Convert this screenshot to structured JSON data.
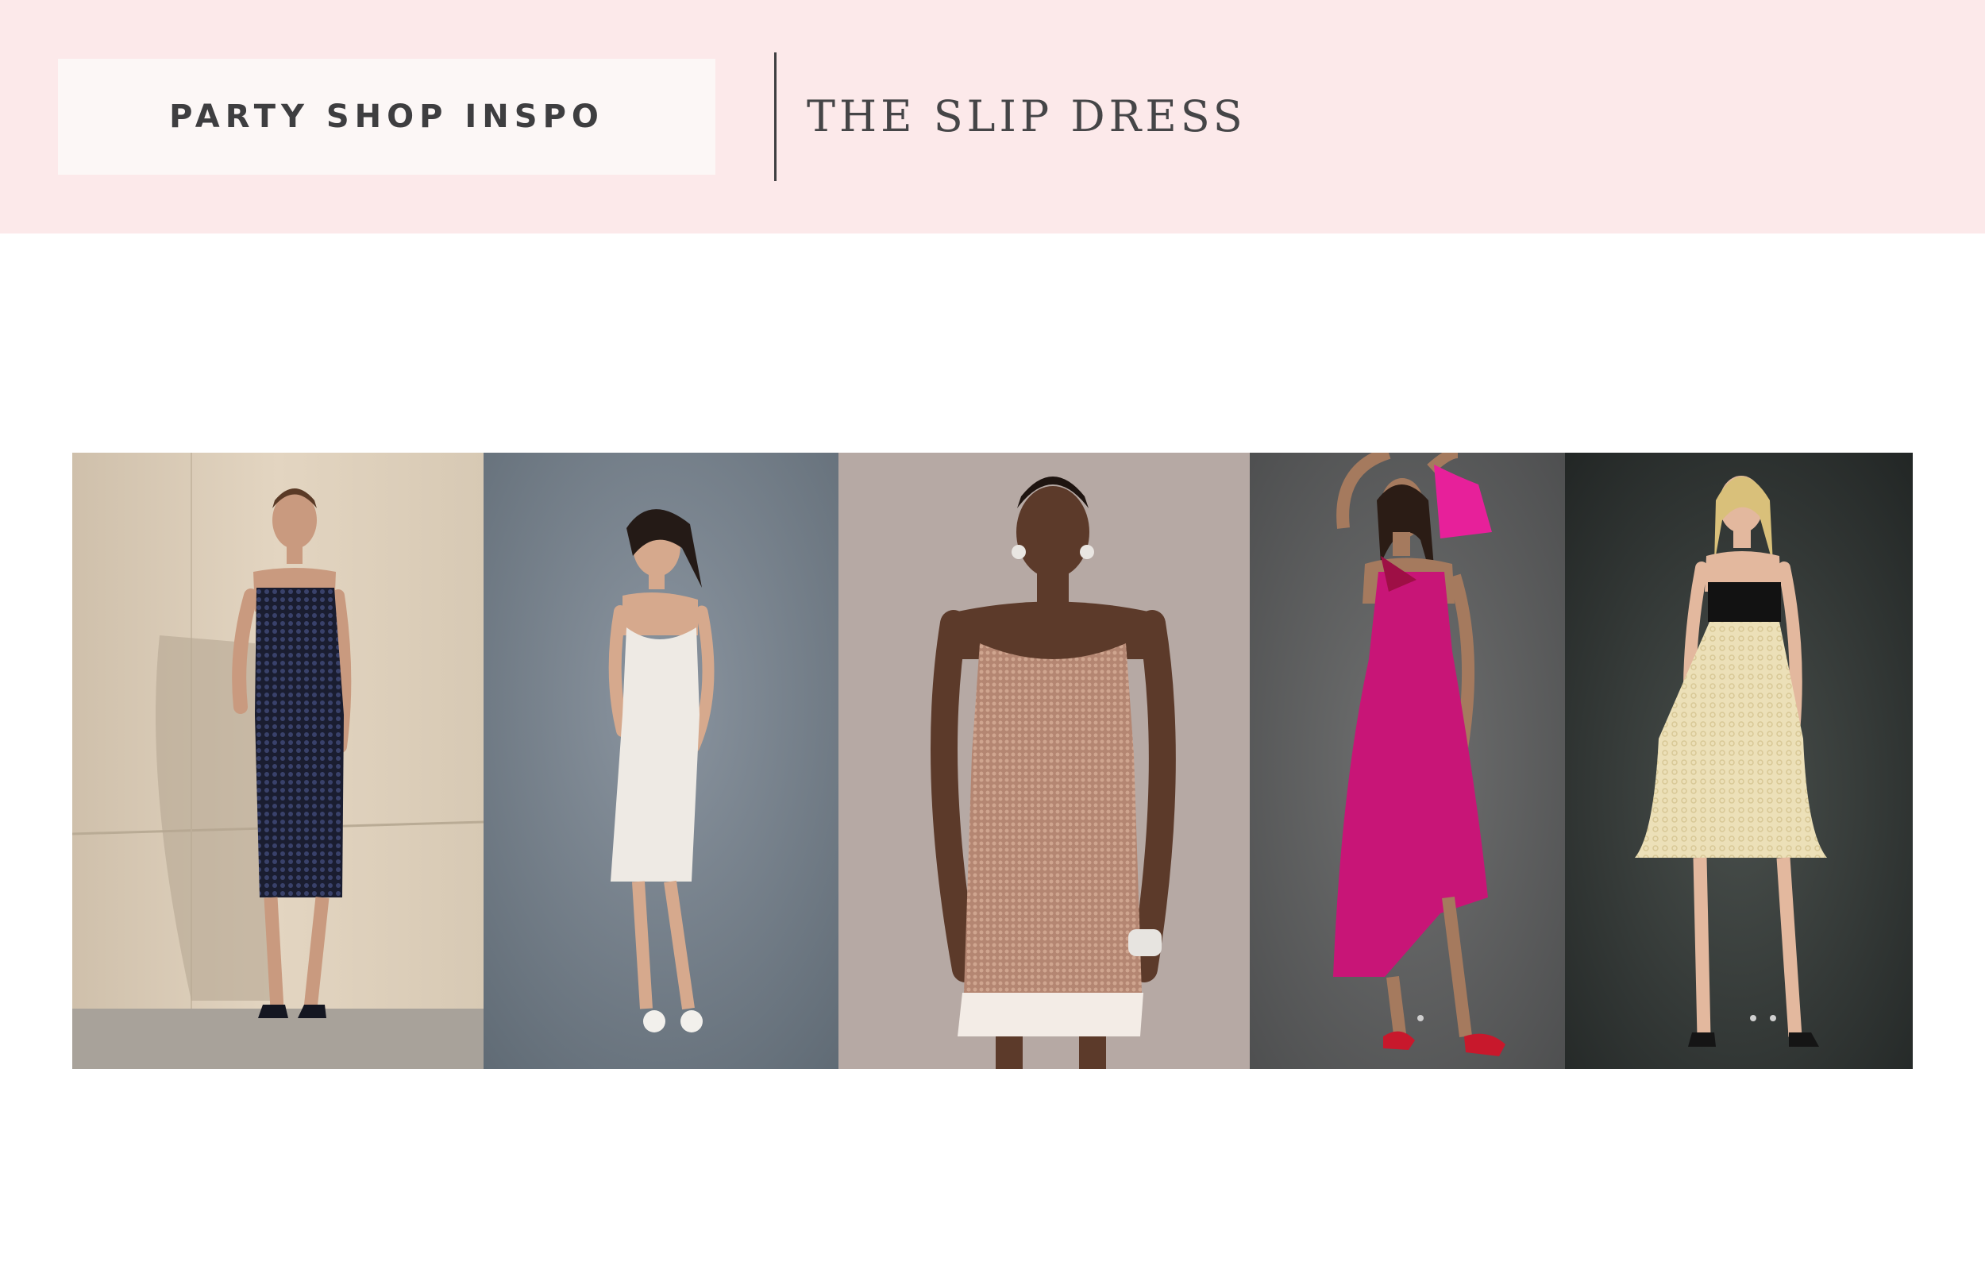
{
  "header": {
    "label": "PARTY SHOP INSPO",
    "title": "THE SLIP DRESS"
  },
  "gallery": {
    "photos": [
      {
        "name": "black-sequin-slip-dress",
        "dress_color": "#1d2136",
        "background": "#d9cbb6"
      },
      {
        "name": "white-lace-slip-dress",
        "dress_color": "#eeeae4",
        "background": "#75808a"
      },
      {
        "name": "blush-sequin-slip-dress",
        "dress_color": "#b98d79",
        "background": "#b6a9a4"
      },
      {
        "name": "magenta-satin-slip-dress",
        "dress_color": "#c81577",
        "background": "#5c5d5e"
      },
      {
        "name": "cream-lace-babydoll-dress",
        "dress_color": "#ece0b8",
        "background": "#2e3332"
      }
    ]
  }
}
